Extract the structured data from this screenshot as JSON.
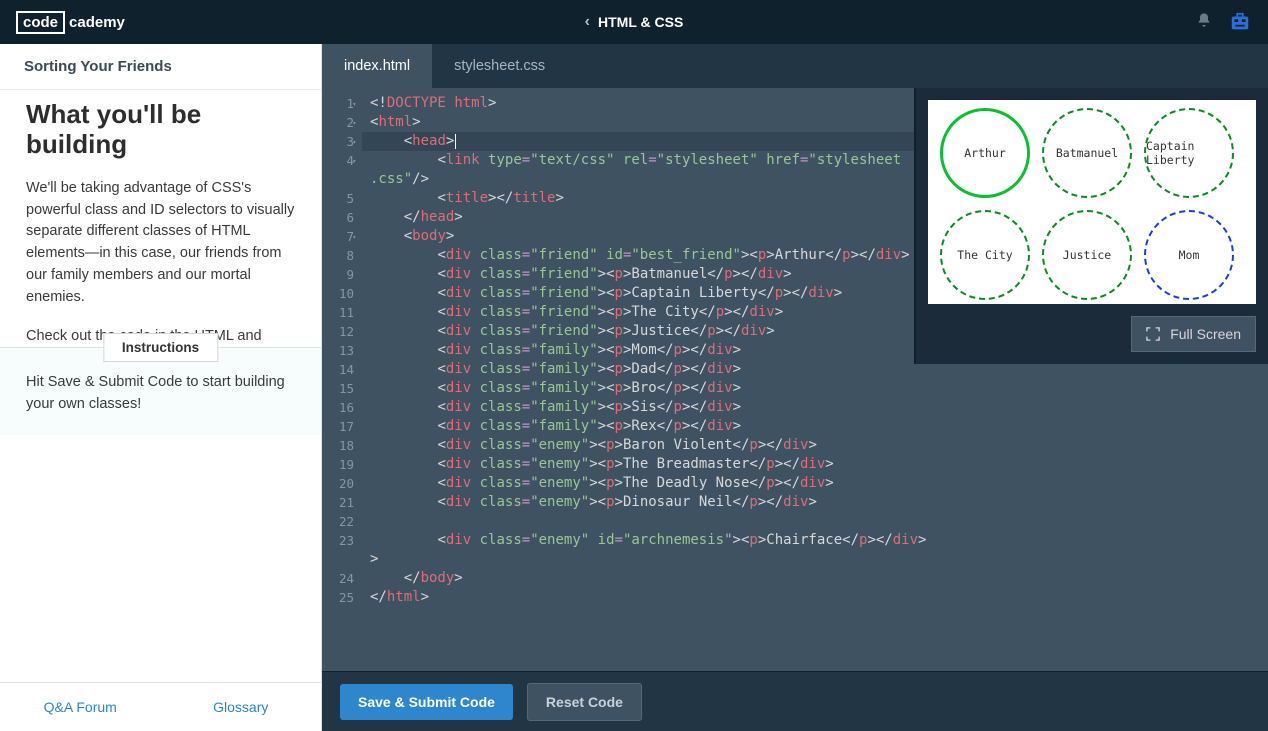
{
  "logo": {
    "box": "code",
    "text": "cademy"
  },
  "breadcrumb": "HTML & CSS",
  "sidebar": {
    "header": "Sorting Your Friends",
    "title": "What you'll be building",
    "p1": "We'll be taking advantage of CSS's powerful class and ID selectors to visually separate different classes of HTML elements—in this case, our friends from our family members and our mortal enemies.",
    "p2": "Check out the code in the HTML and CSS tabs, then take a look at the Result tab to see what the fruits of your labor will be.",
    "instructions_label": "Instructions",
    "instructions_text": "Hit Save & Submit Code to start building your own classes!",
    "qa": "Q&A Forum",
    "glossary": "Glossary"
  },
  "tabs": {
    "t1": "index.html",
    "t2": "stylesheet.css"
  },
  "code": {
    "doctype_html": "html",
    "html": "html",
    "head": "head",
    "link": "link",
    "title": "title",
    "body": "body",
    "div": "div",
    "p": "p",
    "type_attr": "type",
    "rel_attr": "rel",
    "href_attr": "href",
    "class_attr": "class",
    "id_attr": "id",
    "type_val": "\"text/css\"",
    "rel_val": "\"stylesheet\"",
    "href_val": "\"stylesheet",
    "css_suffix": ".css\"",
    "friend": "\"friend\"",
    "family": "\"family\"",
    "enemy": "\"enemy\"",
    "best_friend": "\"best_friend\"",
    "archnemesis": "\"archnemesis\"",
    "arthur": "Arthur",
    "batmanuel": "Batmanuel",
    "captain": "Captain Liberty",
    "city": "The City",
    "justice": "Justice",
    "mom": "Mom",
    "dad": "Dad",
    "bro": "Bro",
    "sis": "Sis",
    "rex": "Rex",
    "baron": "Baron Violent",
    "bread": "The Breadmaster",
    "nose": "The Deadly Nose",
    "dino": "Dinosaur Neil",
    "chair": "Chairface"
  },
  "buttons": {
    "save": "Save & Submit Code",
    "reset": "Reset Code",
    "fullscreen": "Full Screen"
  },
  "circles": [
    "Arthur",
    "Batmanuel",
    "Captain Liberty",
    "The City",
    "Justice",
    "Mom"
  ],
  "line_numbers": [
    "1",
    "2",
    "3",
    "4",
    "",
    "5",
    "6",
    "7",
    "8",
    "9",
    "10",
    "11",
    "12",
    "13",
    "14",
    "15",
    "16",
    "17",
    "18",
    "19",
    "20",
    "21",
    "22",
    "23",
    "",
    "24",
    "25"
  ]
}
